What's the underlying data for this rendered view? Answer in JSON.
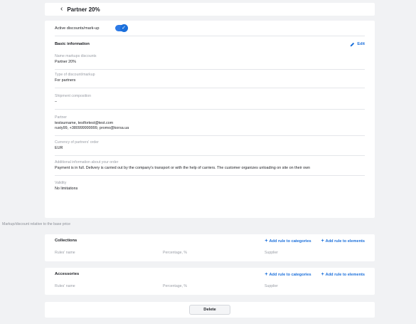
{
  "header": {
    "back_icon": "chevron-left-icon",
    "title": "Partner 20%"
  },
  "toggle": {
    "label": "Active discounts/mark-up",
    "checked": true
  },
  "basic": {
    "title": "Basic information",
    "edit_label": "Edit",
    "fields": [
      {
        "label": "Name markups discounts",
        "lines": [
          "Partner 20%"
        ]
      },
      {
        "label": "Type of discount/markup",
        "lines": [
          "For partners"
        ]
      },
      {
        "label": "Shipment composition",
        "lines": [
          "–"
        ]
      },
      {
        "label": "Partner",
        "lines": [
          "testsurname, testfortest@test.com",
          "rusty99, +380999999999, promo@korsa.ua"
        ]
      },
      {
        "label": "Currency of partners' order",
        "lines": [
          "EUR"
        ]
      },
      {
        "label": "Additional information about your order",
        "lines": [
          "Payment is in full. Delivery is carried out by the company's transport or with the help of carriers. The customer organizes unloading on site on their own"
        ]
      },
      {
        "label": "Validity",
        "lines": [
          "No limitations"
        ]
      }
    ]
  },
  "markup": {
    "caption": "Markup/discount relative to the base price",
    "add_categories": "Add rule to categories",
    "add_elements": "Add rule to elements",
    "columns": {
      "name": "Rules' name",
      "percentage": "Percentage, %",
      "supplier": "Supplier"
    },
    "groups": [
      {
        "title": "Collections"
      },
      {
        "title": "Accessories"
      }
    ]
  },
  "delete_label": "Delete",
  "colors": {
    "accent": "#1a6fdb",
    "background": "#f1f2f4"
  }
}
